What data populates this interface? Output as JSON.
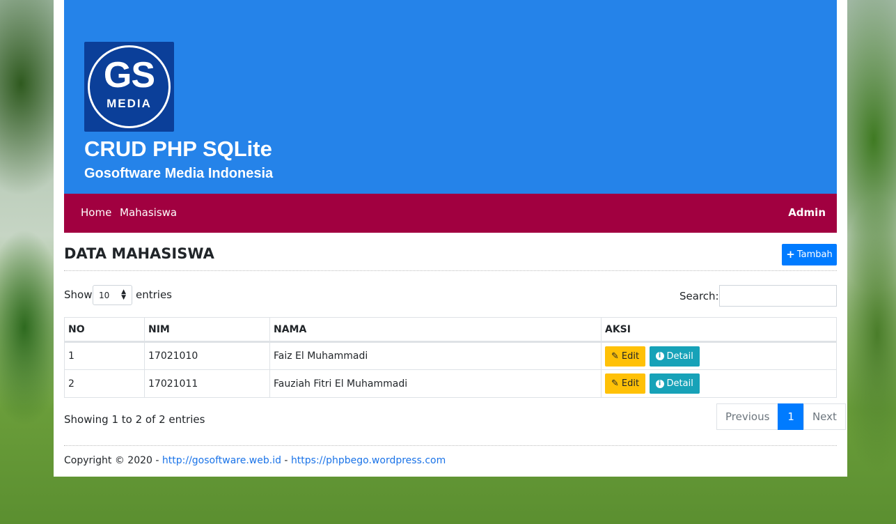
{
  "header": {
    "logo": {
      "line1": "GS",
      "line2": "MEDIA"
    },
    "title": "CRUD PHP SQLite",
    "subtitle": "Gosoftware Media Indonesia",
    "color": "#2583e9"
  },
  "nav": {
    "color": "#a10040",
    "items": [
      "Home",
      "Mahasiswa"
    ],
    "user": "Admin"
  },
  "page": {
    "title": "DATA MAHASISWA",
    "add_button": {
      "icon": "plus-icon",
      "label": "Tambah"
    }
  },
  "table_controls": {
    "show_label": "Show",
    "entries_value": "10",
    "entries_label": "entries",
    "search_label": "Search:",
    "search_value": ""
  },
  "table": {
    "columns": [
      "NO",
      "NIM",
      "NAMA",
      "AKSI"
    ],
    "rows": [
      {
        "no": "1",
        "nim": "17021010",
        "nama": "Faiz El Muhammadi"
      },
      {
        "no": "2",
        "nim": "17021011",
        "nama": "Fauziah Fitri El Muhammadi"
      }
    ],
    "edit_label": "Edit",
    "edit_icon": "edit-icon",
    "detail_label": "Detail",
    "detail_icon": "info-icon"
  },
  "info": "Showing 1 to 2 of 2 entries",
  "pagination": {
    "previous": "Previous",
    "current": "1",
    "next": "Next"
  },
  "footer": {
    "copyright": "Copyright © 2020 - ",
    "link1": "http://gosoftware.web.id",
    "separator": " - ",
    "link2": "https://phpbego.wordpress.com"
  }
}
